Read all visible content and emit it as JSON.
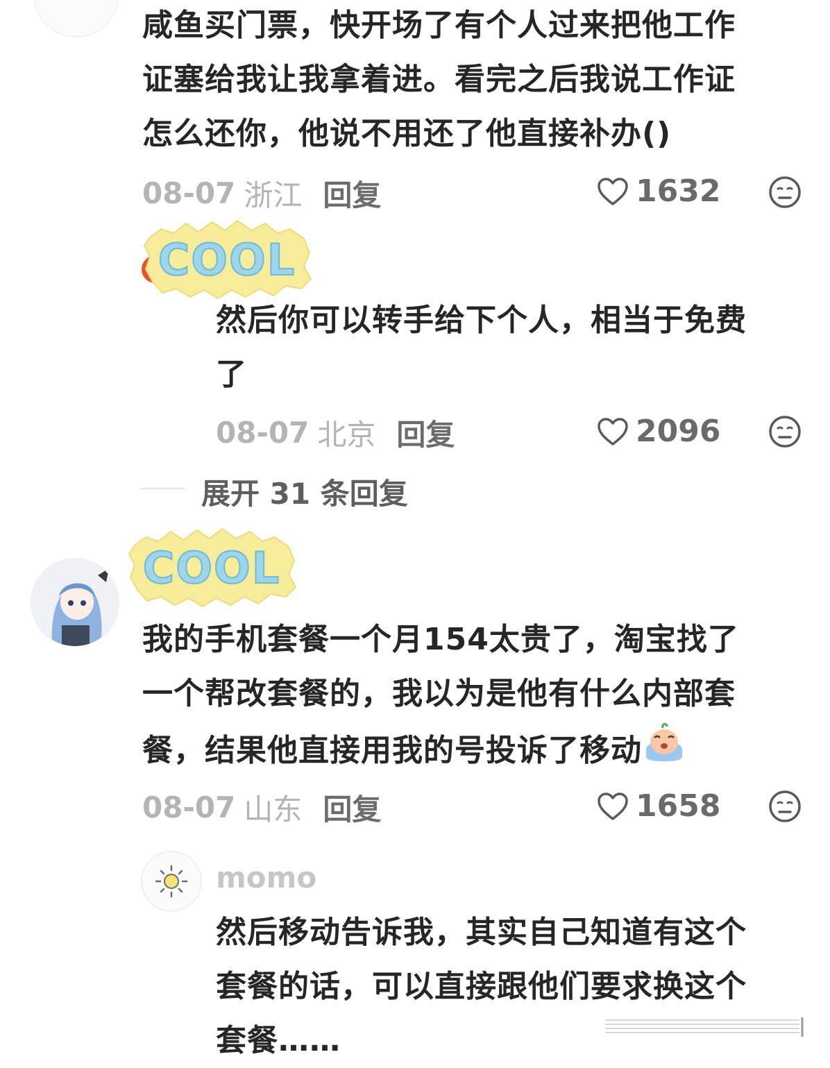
{
  "comments": [
    {
      "lines": [
        "咸鱼买门票，快开场了有个人过来把他工作",
        "证塞给我让我拿着进。看完之后我说工作证",
        "怎么还你，他说不用还了他直接补办()"
      ],
      "date": "08-07",
      "location": "浙江",
      "reply_label": "回复",
      "likes": "1632"
    },
    {
      "badge_text": "COOL",
      "lines": [
        "然后你可以转手给下个人，相当于免费",
        "了"
      ],
      "date": "08-07",
      "location": "北京",
      "reply_label": "回复",
      "likes": "2096"
    },
    {
      "badge_text": "COOL",
      "lines": [
        "我的手机套餐一个月154太贵了，淘宝找了",
        "一个帮改套餐的，我以为是他有什么内部套",
        "餐，结果他直接用我的号投诉了移动"
      ],
      "date": "08-07",
      "location": "山东",
      "reply_label": "回复",
      "likes": "1658"
    },
    {
      "username": "momo",
      "lines": [
        "然后移动告诉我，其实自己知道有这个",
        "套餐的话，可以直接跟他们要求换这个",
        "套餐……"
      ]
    }
  ],
  "expand": {
    "label": "展开 31 条回复"
  },
  "icons": {
    "like": "heart-icon",
    "reaction": "face-icon",
    "avatar_sun": "sun-icon"
  },
  "colors": {
    "text": "#262626",
    "meta": "#b4b4b4",
    "reply": "#6c6c6c",
    "badge_bg": "#f7ec9a"
  }
}
